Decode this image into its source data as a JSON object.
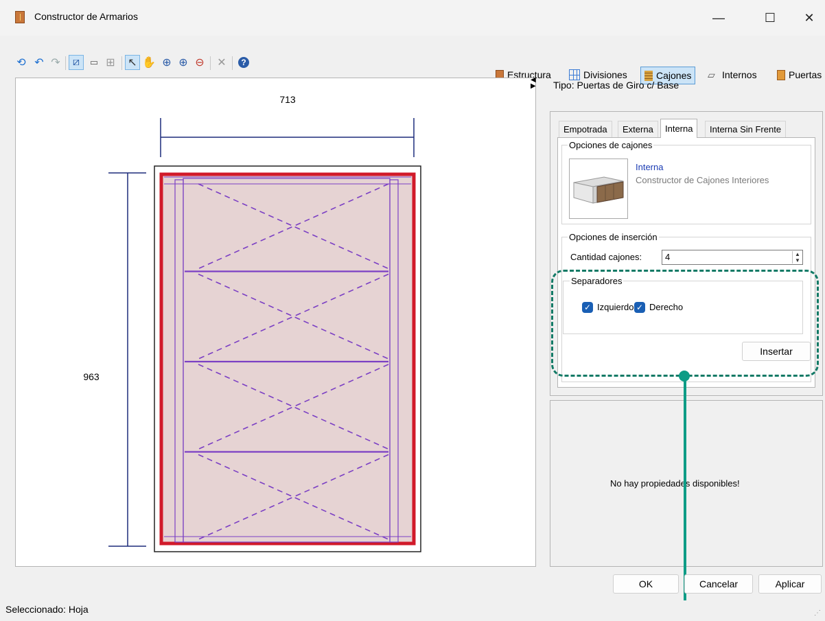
{
  "window": {
    "title": "Constructor de Armarios",
    "minimize": "—",
    "maximize": "☐",
    "close": "✕"
  },
  "toolbar": {
    "tabs": [
      {
        "label": "Estructura",
        "icon": "cabinet-icon"
      },
      {
        "label": "Divisiones",
        "icon": "grid-icon"
      },
      {
        "label": "Cajones",
        "icon": "drawers-icon"
      },
      {
        "label": "Internos",
        "icon": "shelves-icon"
      },
      {
        "label": "Puertas",
        "icon": "door-icon"
      }
    ],
    "active_tab": "Cajones"
  },
  "canvas": {
    "width_dim": "713",
    "height_dim": "963"
  },
  "panel": {
    "tipo": "Tipo: Puertas de Giro c/ Base",
    "tabs": [
      "Empotrada",
      "Externa",
      "Interna",
      "Interna Sin Frente"
    ],
    "active_tab": "Interna",
    "drawer_options": {
      "group_label": "Opciones de cajones",
      "item_title": "Interna",
      "item_desc": "Constructor de Cajones Interiores"
    },
    "insert_options": {
      "group_label": "Opciones de inserción",
      "qty_label": "Cantidad cajones:",
      "qty_value": "4"
    },
    "separators": {
      "group_label": "Separadores",
      "left_label": "Izquierdo",
      "left_checked": true,
      "right_label": "Derecho",
      "right_checked": true
    },
    "insert_button": "Insertar",
    "properties_message": "No hay propiedades disponibles!"
  },
  "buttons": {
    "ok": "OK",
    "cancel": "Cancelar",
    "apply": "Aplicar"
  },
  "status": "Seleccionado: Hoja",
  "colors": {
    "accent_highlight": "#127a66",
    "drawer_fill": "#e6d3d3",
    "frame_red": "#d11a2a",
    "guide_purple": "#7b3fc4",
    "dimension_navy": "#1b2a7a"
  }
}
